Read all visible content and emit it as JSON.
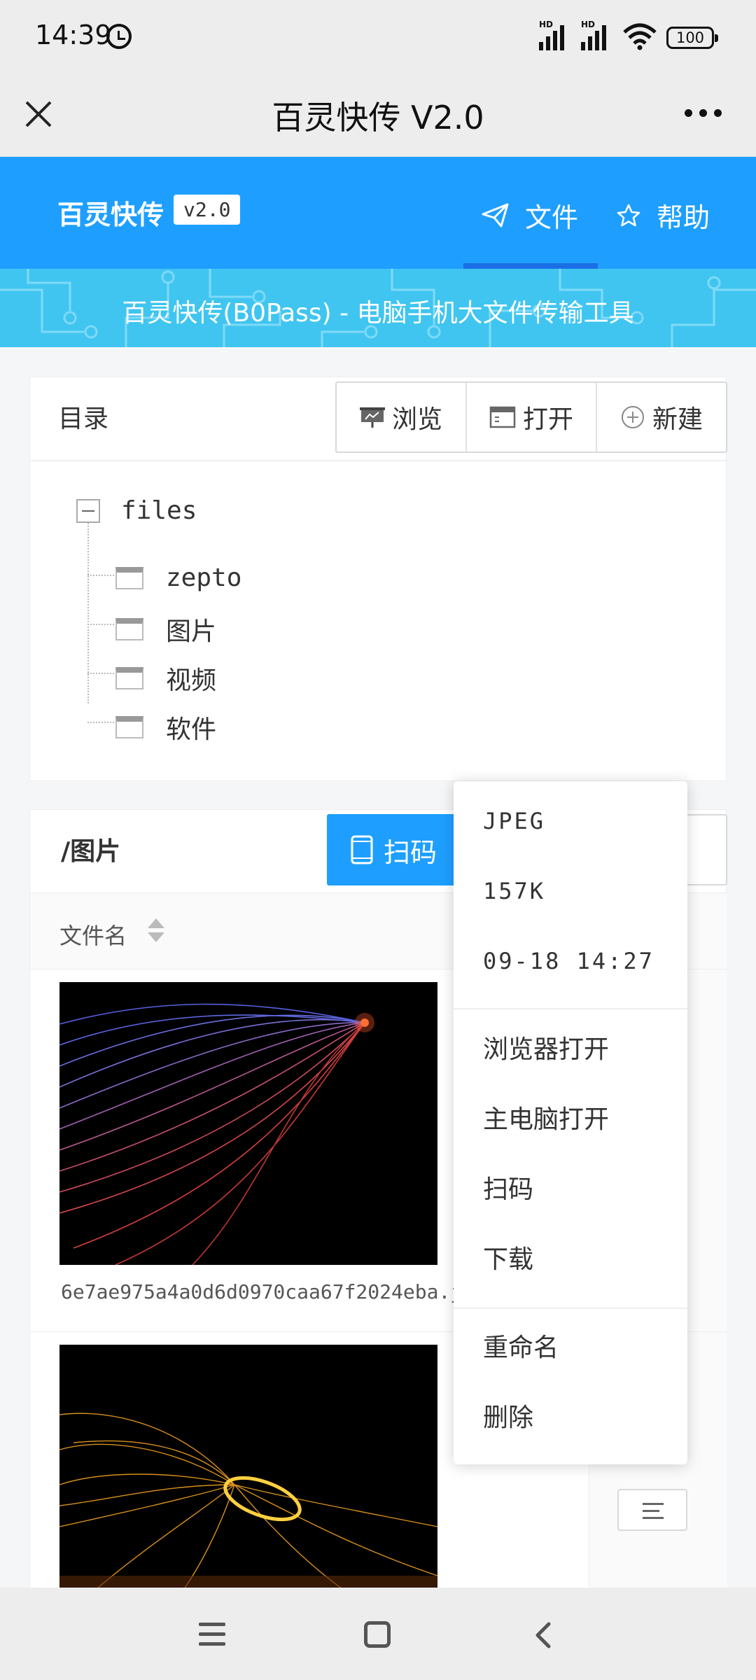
{
  "status_bar": {
    "time": "14:39",
    "battery": "100",
    "sim1": "HD",
    "sim2": "HD"
  },
  "app_bar": {
    "title": "百灵快传 V2.0"
  },
  "header": {
    "brand": "百灵快传",
    "version": "v2.0",
    "nav": {
      "files": "文件",
      "help": "帮助"
    },
    "banner": "百灵快传(B0Pass) - 电脑手机大文件传输工具"
  },
  "directory": {
    "title": "目录",
    "buttons": {
      "browse": "浏览",
      "open": "打开",
      "new": "新建"
    },
    "tree": {
      "root": "files",
      "children": [
        "zepto",
        "图片",
        "视频",
        "软件"
      ]
    }
  },
  "files": {
    "path": "/图片",
    "scan_label": "扫码",
    "column_header": "文件名",
    "rows": [
      {
        "name": "6e7ae975a4a0d6d0970caa67f2024eba.jp…"
      },
      {
        "name": ""
      }
    ]
  },
  "context_menu": {
    "info": [
      "JPEG",
      "157K",
      "09-18 14:27"
    ],
    "actions": [
      "浏览器打开",
      "主电脑打开",
      "扫码",
      "下载"
    ],
    "manage": [
      "重命名",
      "删除"
    ]
  },
  "colors": {
    "primary": "#1e9fff",
    "banner": "#40c5f0",
    "nav_underline": "#1a6fe6"
  }
}
